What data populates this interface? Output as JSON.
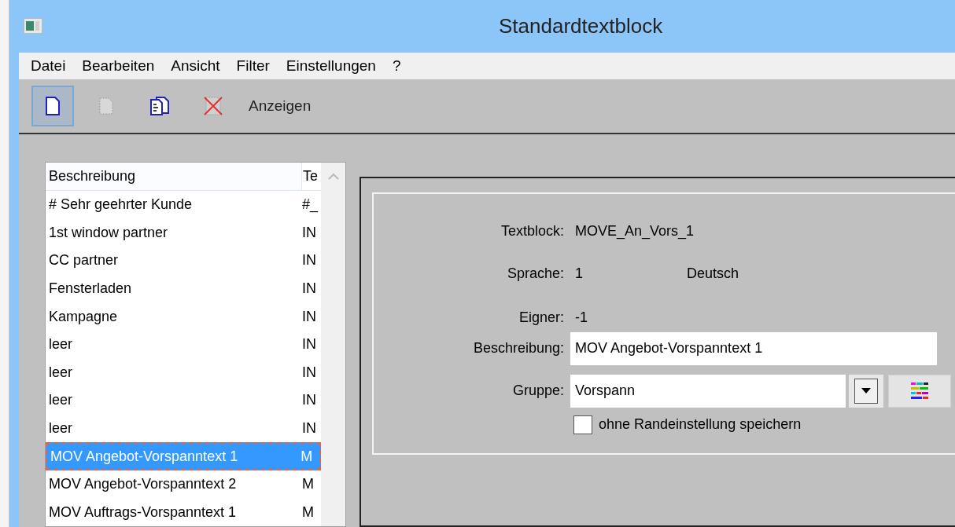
{
  "window": {
    "title": "Standardtextblock"
  },
  "menu": [
    "Datei",
    "Bearbeiten",
    "Ansicht",
    "Filter",
    "Einstellungen",
    "?"
  ],
  "toolbar": [
    {
      "kind": "new",
      "pressed": true,
      "disabled": false
    },
    {
      "kind": "blank",
      "pressed": false,
      "disabled": true
    },
    {
      "kind": "copy",
      "pressed": false,
      "disabled": false
    },
    {
      "kind": "delete",
      "pressed": false,
      "disabled": true
    },
    {
      "kind": "text",
      "label": "Anzeigen",
      "pressed": false,
      "disabled": false
    }
  ],
  "list": {
    "columns": [
      "Beschreibung",
      "Te"
    ],
    "rows": [
      {
        "cells": [
          "# Sehr geehrter Kunde",
          "#_"
        ],
        "selected": false
      },
      {
        "cells": [
          "1st window partner",
          "IN"
        ],
        "selected": false
      },
      {
        "cells": [
          "CC partner",
          "IN"
        ],
        "selected": false
      },
      {
        "cells": [
          "Fensterladen",
          "IN"
        ],
        "selected": false
      },
      {
        "cells": [
          "Kampagne",
          "IN"
        ],
        "selected": false
      },
      {
        "cells": [
          "leer",
          "IN"
        ],
        "selected": false
      },
      {
        "cells": [
          "leer",
          "IN"
        ],
        "selected": false
      },
      {
        "cells": [
          "leer",
          "IN"
        ],
        "selected": false
      },
      {
        "cells": [
          "leer",
          "IN"
        ],
        "selected": false
      },
      {
        "cells": [
          "MOV Angebot-Vorspanntext 1",
          "M"
        ],
        "selected": true
      },
      {
        "cells": [
          "MOV Angebot-Vorspanntext 2",
          "M"
        ],
        "selected": false
      },
      {
        "cells": [
          "MOV Auftrags-Vorspanntext 1",
          "M"
        ],
        "selected": false
      }
    ]
  },
  "form": {
    "textblock": {
      "label": "Textblock:",
      "value": "MOVE_An_Vors_1"
    },
    "sprache": {
      "label": "Sprache:",
      "value": "1",
      "name": "Deutsch"
    },
    "eigner": {
      "label": "Eigner:",
      "value": "-1"
    },
    "beschreibung": {
      "label": "Beschreibung:",
      "value": "MOV Angebot-Vorspanntext 1"
    },
    "gruppe": {
      "label": "Gruppe:",
      "value": "Vorspann"
    },
    "checkbox": {
      "label": "ohne Randeinstellung speichern",
      "checked": false
    }
  }
}
